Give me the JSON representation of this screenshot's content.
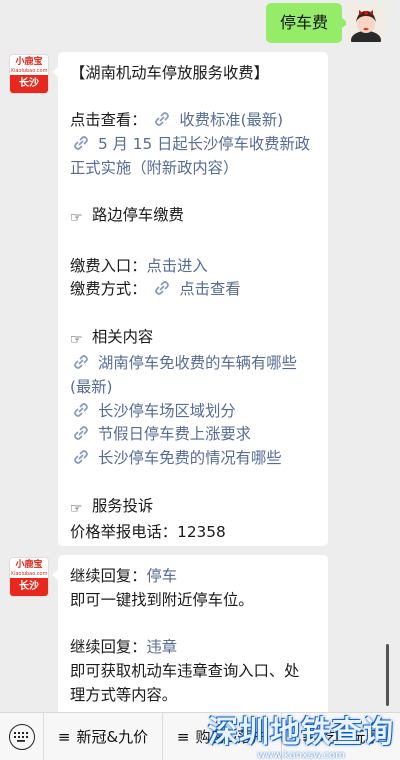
{
  "user_message": {
    "text": "停车费"
  },
  "account": {
    "avatar_brand": "小鹿宝",
    "avatar_domain": "Xiaolubao.com",
    "avatar_city": "长沙"
  },
  "message1": {
    "title": "【湖南机动车停放服务收费】",
    "click_view_label": "点击查看：",
    "link_fee_standard": "收费标准(最新)",
    "link_may15_a": "5 月 15 日起长沙停车收费新政",
    "link_may15_b": "正式实施（附新政内容）",
    "section_roadside": "路边停车缴费",
    "pay_entry_label": "缴费入口：",
    "pay_entry_link": "点击进入",
    "pay_method_label": "缴费方式：",
    "pay_method_link": "点击查看",
    "section_related": "相关内容",
    "related_1a": "湖南停车免收费的车辆有哪些",
    "related_1b": "(最新)",
    "related_2": "长沙停车场区域划分",
    "related_3": "节假日停车费上涨要求",
    "related_4": "长沙停车免费的情况有哪些",
    "section_complaint": "服务投诉",
    "hotline_label": "价格举报电话：",
    "hotline_number": "12358"
  },
  "message2": {
    "reply1_label": "继续回复：",
    "reply1_keyword": "停车",
    "reply1_desc": "即可一键找到附近停车位。",
    "reply2_label": "继续回复：",
    "reply2_keyword": "违章",
    "reply2_desc_a": "即可获取机动车违章查询入口、处",
    "reply2_desc_b": "理方式等内容。"
  },
  "menu": {
    "items": [
      {
        "label": "新冠&九价"
      },
      {
        "label": "购房&落户"
      },
      {
        "label": "吃喝玩乐"
      }
    ]
  },
  "watermark": {
    "title": "深圳地铁查询",
    "site": "www.kanxsw.com"
  }
}
